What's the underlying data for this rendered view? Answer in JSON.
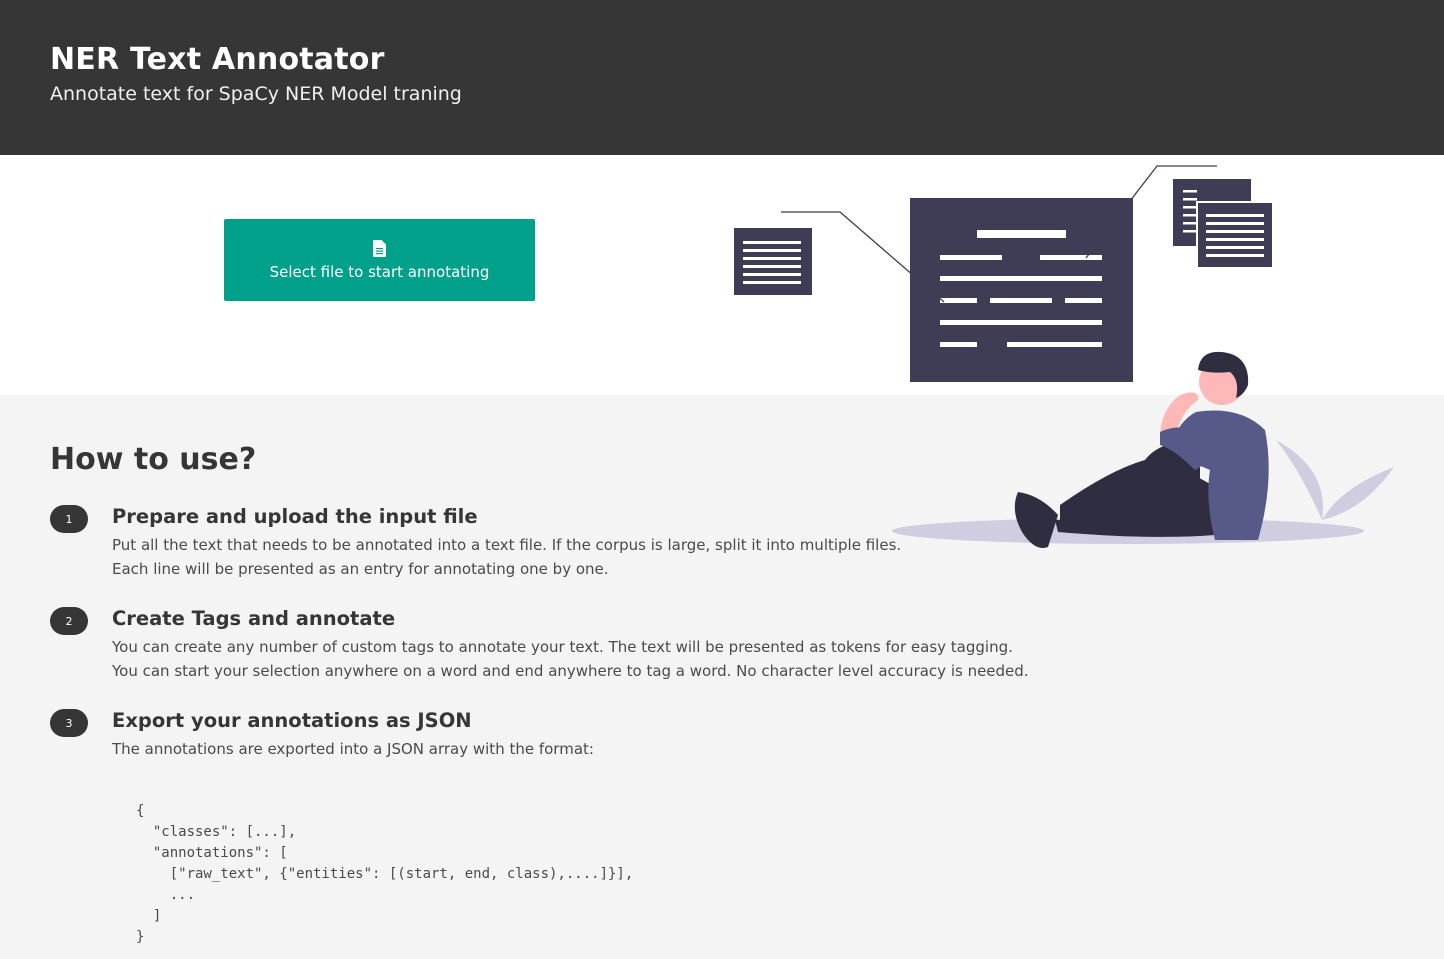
{
  "header": {
    "title": "NER Text Annotator",
    "subtitle": "Annotate text for SpaCy NER Model traning"
  },
  "hero": {
    "select_button_label": "Select file to start annotating",
    "select_button_icon": "file-icon"
  },
  "howto": {
    "title": "How to use?",
    "steps": [
      {
        "number": "1",
        "title": "Prepare and upload the input file",
        "lines": [
          "Put all the text that needs to be annotated into a text file. If the corpus is large, split it into multiple files.",
          "Each line will be presented as an entry for annotating one by one."
        ]
      },
      {
        "number": "2",
        "title": "Create Tags and annotate",
        "lines": [
          "You can create any number of custom tags to annotate your text. The text will be presented as tokens for easy tagging.",
          "You can start your selection anywhere on a word and end anywhere to tag a word. No character level accuracy is needed."
        ]
      },
      {
        "number": "3",
        "title": "Export your annotations as JSON",
        "lines": [
          "The annotations are exported into a JSON array with the format:"
        ]
      }
    ],
    "code": "{\n  \"classes\": [...],\n  \"annotations\": [\n    [\"raw_text\", {\"entities\": [(start, end, class),....]}],\n    ...\n  ]\n}"
  },
  "colors": {
    "header_bg": "#363636",
    "accent": "#00a08a",
    "illustration_dark": "#3f3d56",
    "illustration_purple": "#575a89",
    "illustration_skin": "#ffb8b8",
    "illustration_shadow": "#d0cde1"
  }
}
